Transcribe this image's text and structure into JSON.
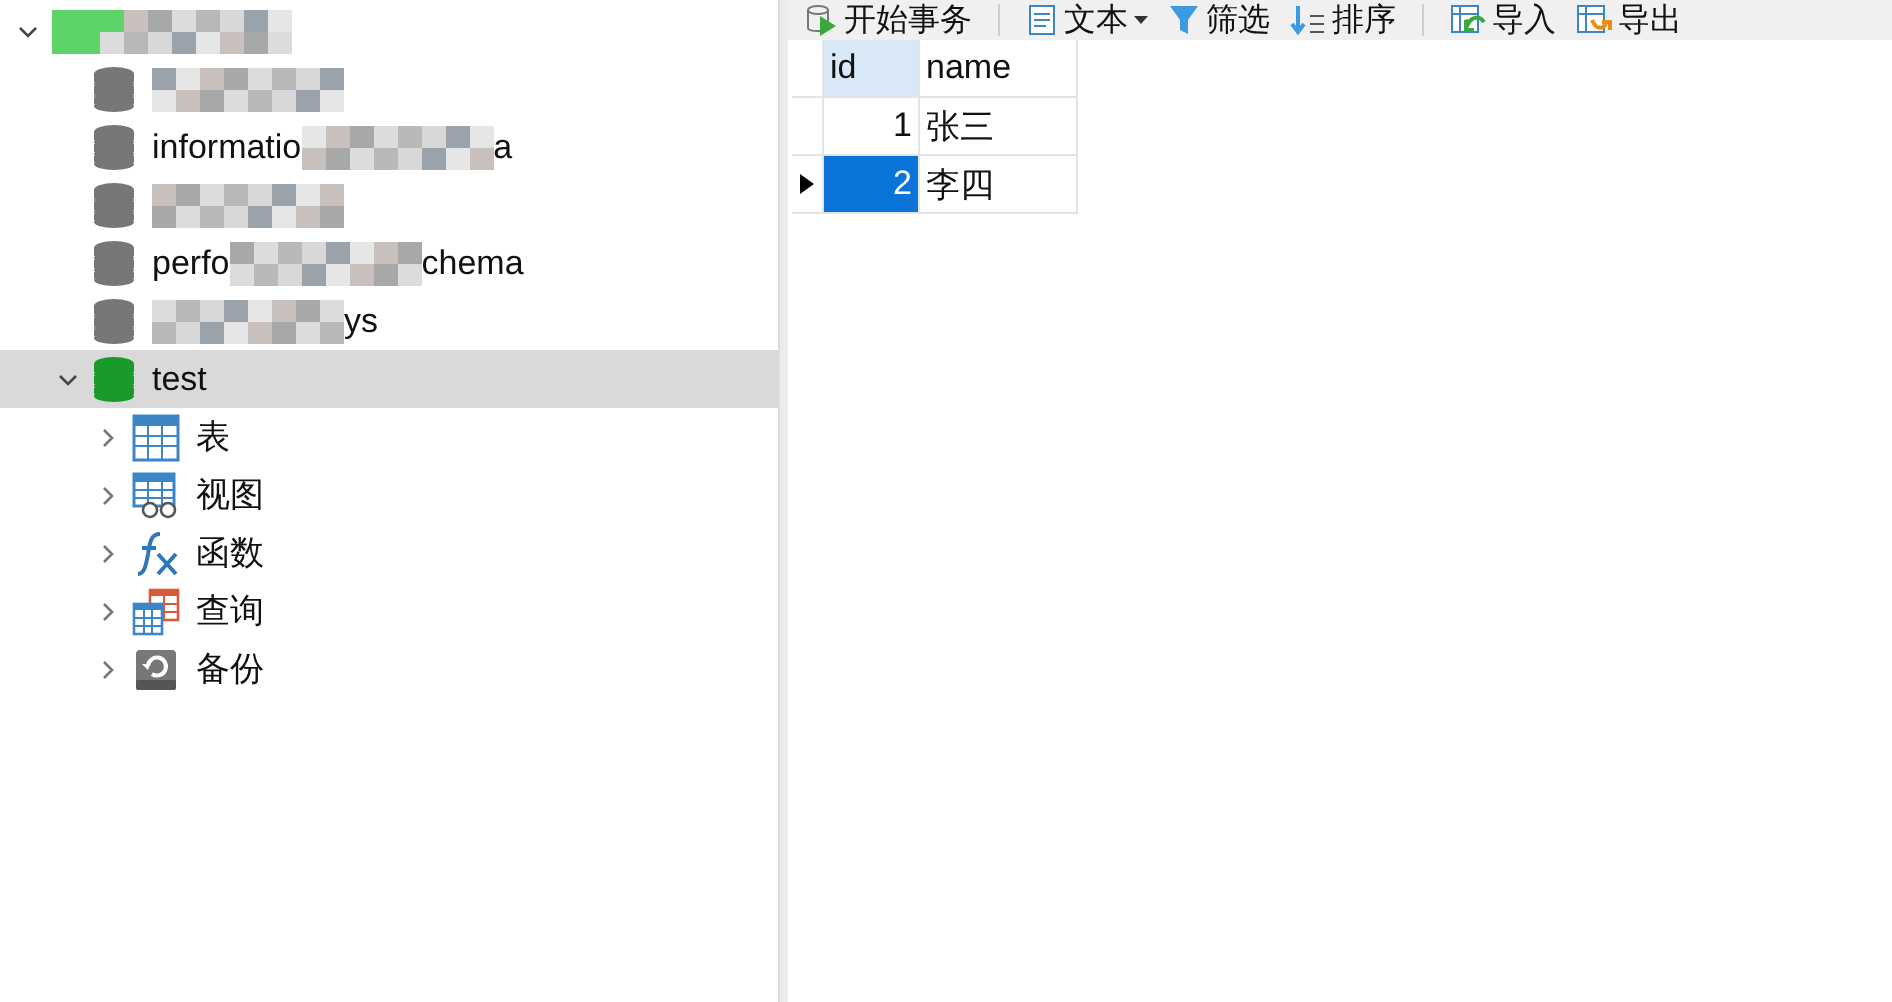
{
  "tree": [
    {
      "kind": "connection",
      "expanded": true,
      "parts": [
        {
          "kind": "blur"
        }
      ],
      "children": [
        {
          "kind": "database",
          "parts": [
            {
              "kind": "blur"
            }
          ]
        },
        {
          "kind": "database",
          "parts": [
            {
              "kind": "text",
              "text": "informatio"
            },
            {
              "kind": "blur"
            },
            {
              "kind": "text",
              "text": "a"
            }
          ]
        },
        {
          "kind": "database",
          "parts": [
            {
              "kind": "blur"
            }
          ]
        },
        {
          "kind": "database",
          "parts": [
            {
              "kind": "text",
              "text": "perfo"
            },
            {
              "kind": "blur"
            },
            {
              "kind": "text",
              "text": "chema"
            }
          ]
        },
        {
          "kind": "database",
          "parts": [
            {
              "kind": "blur"
            },
            {
              "kind": "text",
              "text": "ys"
            }
          ]
        },
        {
          "kind": "database",
          "open": true,
          "selected": true,
          "expanded": true,
          "parts": [
            {
              "kind": "text",
              "text": "test"
            }
          ],
          "children": [
            {
              "kind": "tables",
              "parts": [
                {
                  "kind": "text",
                  "text": "表"
                }
              ],
              "expanded": false
            },
            {
              "kind": "views",
              "parts": [
                {
                  "kind": "text",
                  "text": "视图"
                }
              ],
              "expanded": false
            },
            {
              "kind": "functions",
              "parts": [
                {
                  "kind": "text",
                  "text": "函数"
                }
              ],
              "expanded": false
            },
            {
              "kind": "queries",
              "parts": [
                {
                  "kind": "text",
                  "text": "查询"
                }
              ],
              "expanded": false
            },
            {
              "kind": "backups",
              "parts": [
                {
                  "kind": "text",
                  "text": "备份"
                }
              ],
              "expanded": false
            }
          ]
        }
      ]
    }
  ],
  "toolbar": [
    {
      "kind": "transaction",
      "label": "开始事务"
    },
    {
      "kind": "text",
      "label": "文本",
      "dropdown": true
    },
    {
      "kind": "filter",
      "label": "筛选"
    },
    {
      "kind": "sort",
      "label": "排序"
    },
    {
      "kind": "import",
      "label": "导入"
    },
    {
      "kind": "export",
      "label": "导出"
    }
  ],
  "grid": {
    "columns": [
      "id",
      "name"
    ],
    "rows": [
      {
        "cells": [
          "1",
          "张三"
        ],
        "selected": false
      },
      {
        "cells": [
          "2",
          "李四"
        ],
        "selected": true
      }
    ]
  }
}
